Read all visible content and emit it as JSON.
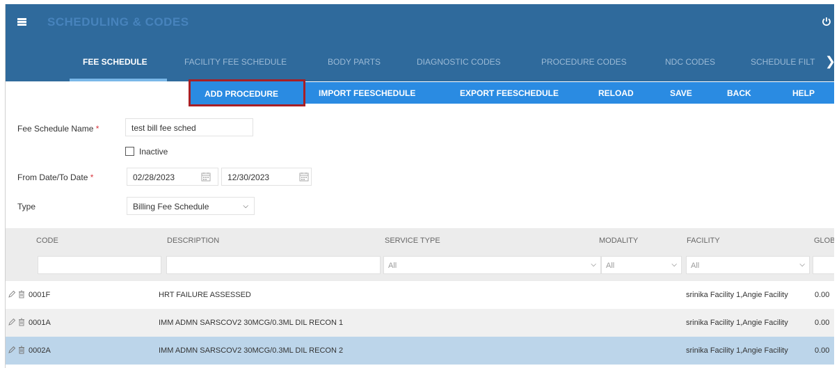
{
  "header": {
    "title": "SCHEDULING & CODES",
    "menu_icon": "hamburger-menu-icon",
    "power_icon": "power-icon"
  },
  "tabs": [
    {
      "label": "FEE SCHEDULE",
      "active": true
    },
    {
      "label": "FACILITY FEE SCHEDULE",
      "active": false
    },
    {
      "label": "BODY PARTS",
      "active": false
    },
    {
      "label": "DIAGNOSTIC CODES",
      "active": false
    },
    {
      "label": "PROCEDURE CODES",
      "active": false
    },
    {
      "label": "NDC CODES",
      "active": false
    },
    {
      "label": "SCHEDULE FILT",
      "active": false
    }
  ],
  "toolbar": {
    "add_procedure": "ADD PROCEDURE",
    "import": "IMPORT FEESCHEDULE",
    "export": "EXPORT FEESCHEDULE",
    "reload": "RELOAD",
    "save": "SAVE",
    "back": "BACK",
    "help": "HELP"
  },
  "form": {
    "name_label": "Fee Schedule Name",
    "name_value": "test bill fee sched",
    "inactive_label": "Inactive",
    "inactive_checked": false,
    "date_label": "From Date/To Date",
    "from_date": "02/28/2023",
    "to_date": "12/30/2023",
    "type_label": "Type",
    "type_value": "Billing Fee Schedule",
    "required_mark": "*"
  },
  "grid": {
    "columns": [
      "CODE",
      "DESCRIPTION",
      "SERVICE TYPE",
      "MODALITY",
      "FACILITY",
      "GLOBA"
    ],
    "filters": {
      "service_type": "All",
      "modality": "All",
      "facility": "All"
    },
    "rows": [
      {
        "code": "0001F",
        "description": "HRT FAILURE ASSESSED",
        "facility": "srinika Facility 1,Angie Facility",
        "global": "0.00"
      },
      {
        "code": "0001A",
        "description": "IMM ADMN SARSCOV2 30MCG/0.3ML DIL RECON 1",
        "facility": "srinika Facility 1,Angie Facility",
        "global": "0.00"
      },
      {
        "code": "0002A",
        "description": "IMM ADMN SARSCOV2 30MCG/0.3ML DIL RECON 2",
        "facility": "srinika Facility 1,Angie Facility",
        "global": "0.00"
      }
    ]
  },
  "colors": {
    "header_bg": "#2f6a9c",
    "toolbar_bg": "#2a8be2",
    "highlight_border": "#a81f25",
    "selected_row": "#bcd5ea",
    "required": "#d9363e"
  }
}
